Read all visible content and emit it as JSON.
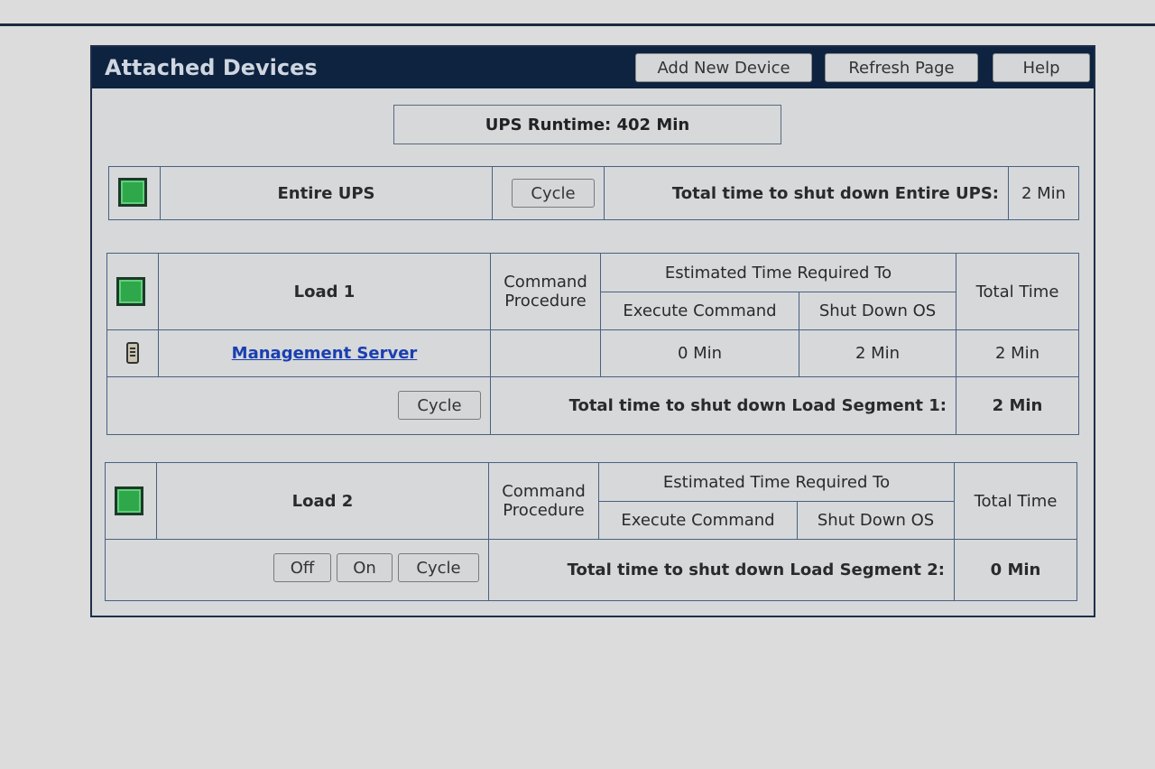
{
  "header": {
    "title": "Attached Devices",
    "buttons": {
      "add_new_device": "Add New Device",
      "refresh_page": "Refresh Page",
      "help": "Help"
    }
  },
  "runtime": "UPS Runtime: 402 Min",
  "entire_ups": {
    "label": "Entire UPS",
    "cycle_label": "Cycle",
    "total_label": "Total time to shut down Entire UPS:",
    "total_value": "2 Min",
    "status_color": "#2ea84a"
  },
  "load1": {
    "label": "Load 1",
    "command_procedure": "Command Procedure",
    "estimated_header": "Estimated Time Required To",
    "execute_command": "Execute Command",
    "shut_down_os": "Shut Down OS",
    "total_time": "Total Time",
    "device": {
      "name": "Management Server",
      "icon": "server-icon",
      "command_procedure": "",
      "execute_command": "0 Min",
      "shut_down_os": "2 Min",
      "total_time": "2 Min"
    },
    "cycle_label": "Cycle",
    "total_label": "Total time to shut down Load Segment 1:",
    "total_value": "2 Min",
    "status_color": "#2ea84a"
  },
  "load2": {
    "label": "Load 2",
    "command_procedure": "Command Procedure",
    "estimated_header": "Estimated Time Required To",
    "execute_command": "Execute Command",
    "shut_down_os": "Shut Down OS",
    "total_time": "Total Time",
    "off_label": "Off",
    "on_label": "On",
    "cycle_label": "Cycle",
    "total_label": "Total time to shut down Load Segment 2:",
    "total_value": "0 Min",
    "status_color": "#2ea84a"
  }
}
